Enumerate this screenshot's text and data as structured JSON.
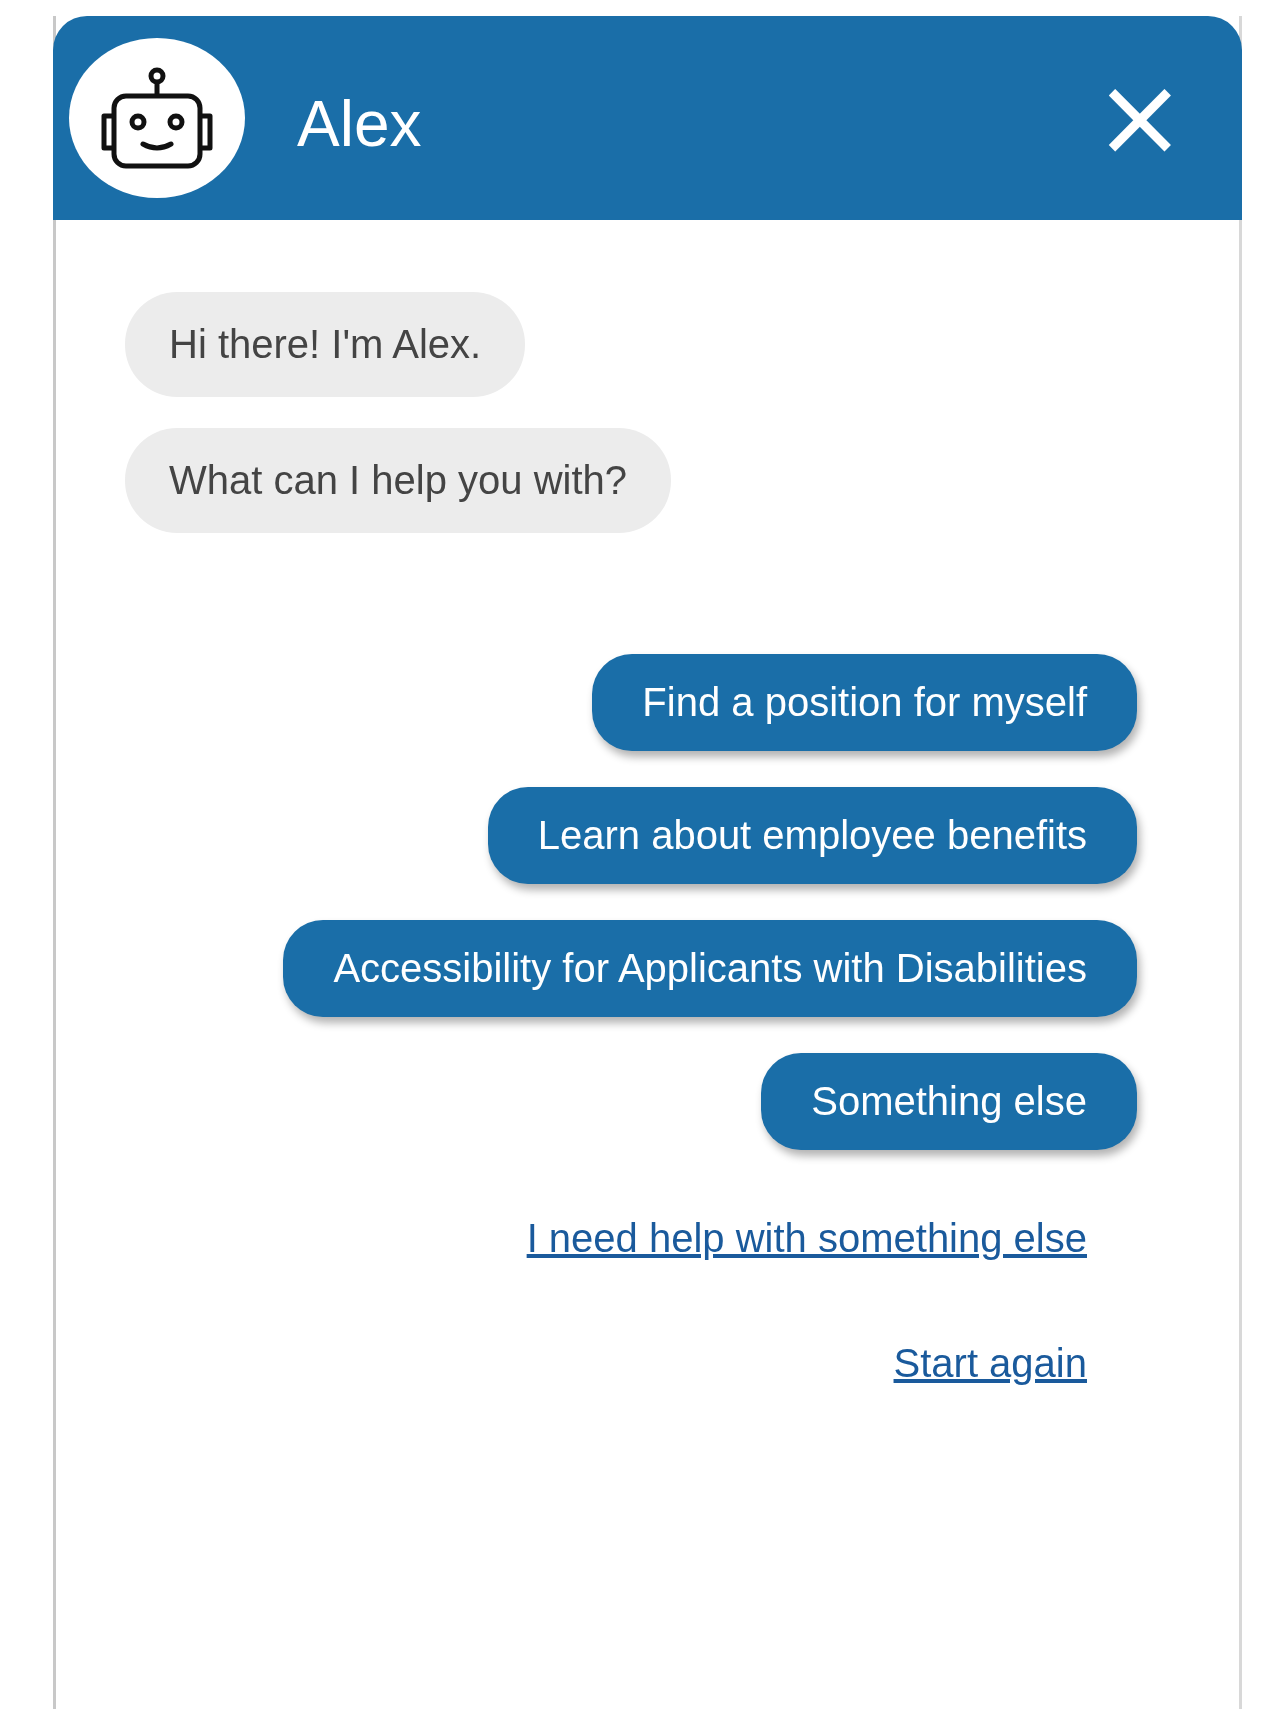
{
  "header": {
    "title": "Alex",
    "close": "×"
  },
  "messages": [
    "Hi there! I'm Alex.",
    "What can I help you with?"
  ],
  "options": [
    "Find a position for myself",
    "Learn about employee benefits",
    "Accessibility for Applicants with Disabilities",
    "Something else"
  ],
  "links": [
    "I need help with something else",
    "Start again"
  ]
}
